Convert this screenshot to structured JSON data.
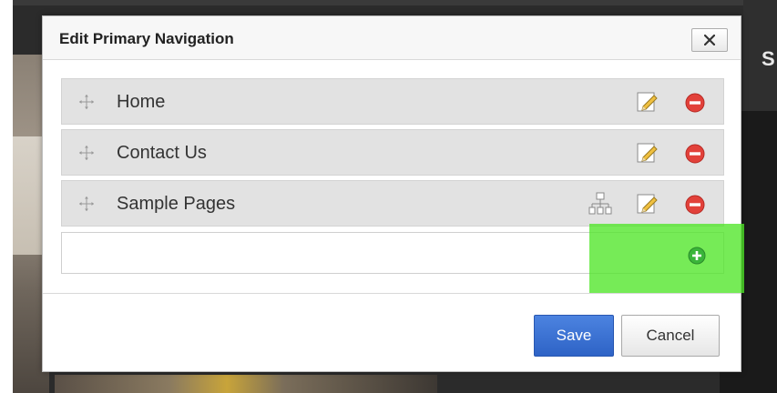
{
  "dialog": {
    "title": "Edit Primary Navigation",
    "close_icon": "close-icon"
  },
  "nav_items": [
    {
      "label": "Home",
      "icons": [
        "drag-handle-icon",
        "pencil-edit-icon",
        "remove-icon"
      ]
    },
    {
      "label": "Contact Us",
      "icons": [
        "drag-handle-icon",
        "pencil-edit-icon",
        "remove-icon"
      ]
    },
    {
      "label": "Sample Pages",
      "icons": [
        "drag-handle-icon",
        "sitemap-icon",
        "pencil-edit-icon",
        "remove-icon"
      ]
    }
  ],
  "add_row": {
    "value": "",
    "icon": "add-icon"
  },
  "footer": {
    "save_label": "Save",
    "cancel_label": "Cancel"
  },
  "background": {
    "partial_text": "S"
  },
  "colors": {
    "save_button": "#3a6fd2",
    "remove_icon": "#e2413a",
    "add_icon": "#3ab53a",
    "highlight": "#50e628"
  }
}
